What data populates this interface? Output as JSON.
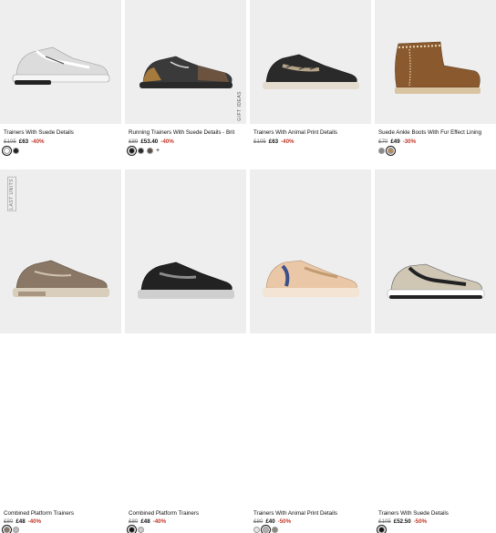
{
  "products": [
    {
      "title": "Trainers With Suede Details",
      "old": "£105",
      "new": "£63",
      "disc": "-40%",
      "swatches": [
        "#ffffff",
        "#222222"
      ]
    },
    {
      "title": "Running Trainers With Suede Details - Brit",
      "old": "£89",
      "new": "£53.40",
      "disc": "-40%",
      "swatches": [
        "#1a1a1a",
        "#2a2a2a",
        "#5a4f46"
      ],
      "more": "+",
      "badge": "GIFT IDEAS"
    },
    {
      "title": "Trainers With Animal Print Details",
      "old": "£105",
      "new": "£63",
      "disc": "-40%",
      "swatches": []
    },
    {
      "title": "Suede Ankle Boots With Fur Effect Lining",
      "old": "£70",
      "new": "£49",
      "disc": "-30%",
      "swatches": [
        "#8a8a86",
        "#b88a5a"
      ]
    },
    {
      "title": "Combined Platform Trainers",
      "old": "£80",
      "new": "£48",
      "disc": "-40%",
      "swatches": [
        "#8a7765",
        "#bdbdbd"
      ],
      "badge": "LAST UNITS"
    },
    {
      "title": "Combined Platform Trainers",
      "old": "£80",
      "new": "£48",
      "disc": "-40%",
      "swatches": [
        "#111111",
        "#cccccc"
      ]
    },
    {
      "title": "Trainers With Animal Print Details",
      "old": "£80",
      "new": "£40",
      "disc": "-50%",
      "swatches": [
        "#e6e6e6",
        "#b0b0b0",
        "#8a8a7a"
      ]
    },
    {
      "title": "Trainers With Suede Details",
      "old": "£105",
      "new": "£52.50",
      "disc": "-50%",
      "swatches": [
        "#111111"
      ]
    }
  ]
}
